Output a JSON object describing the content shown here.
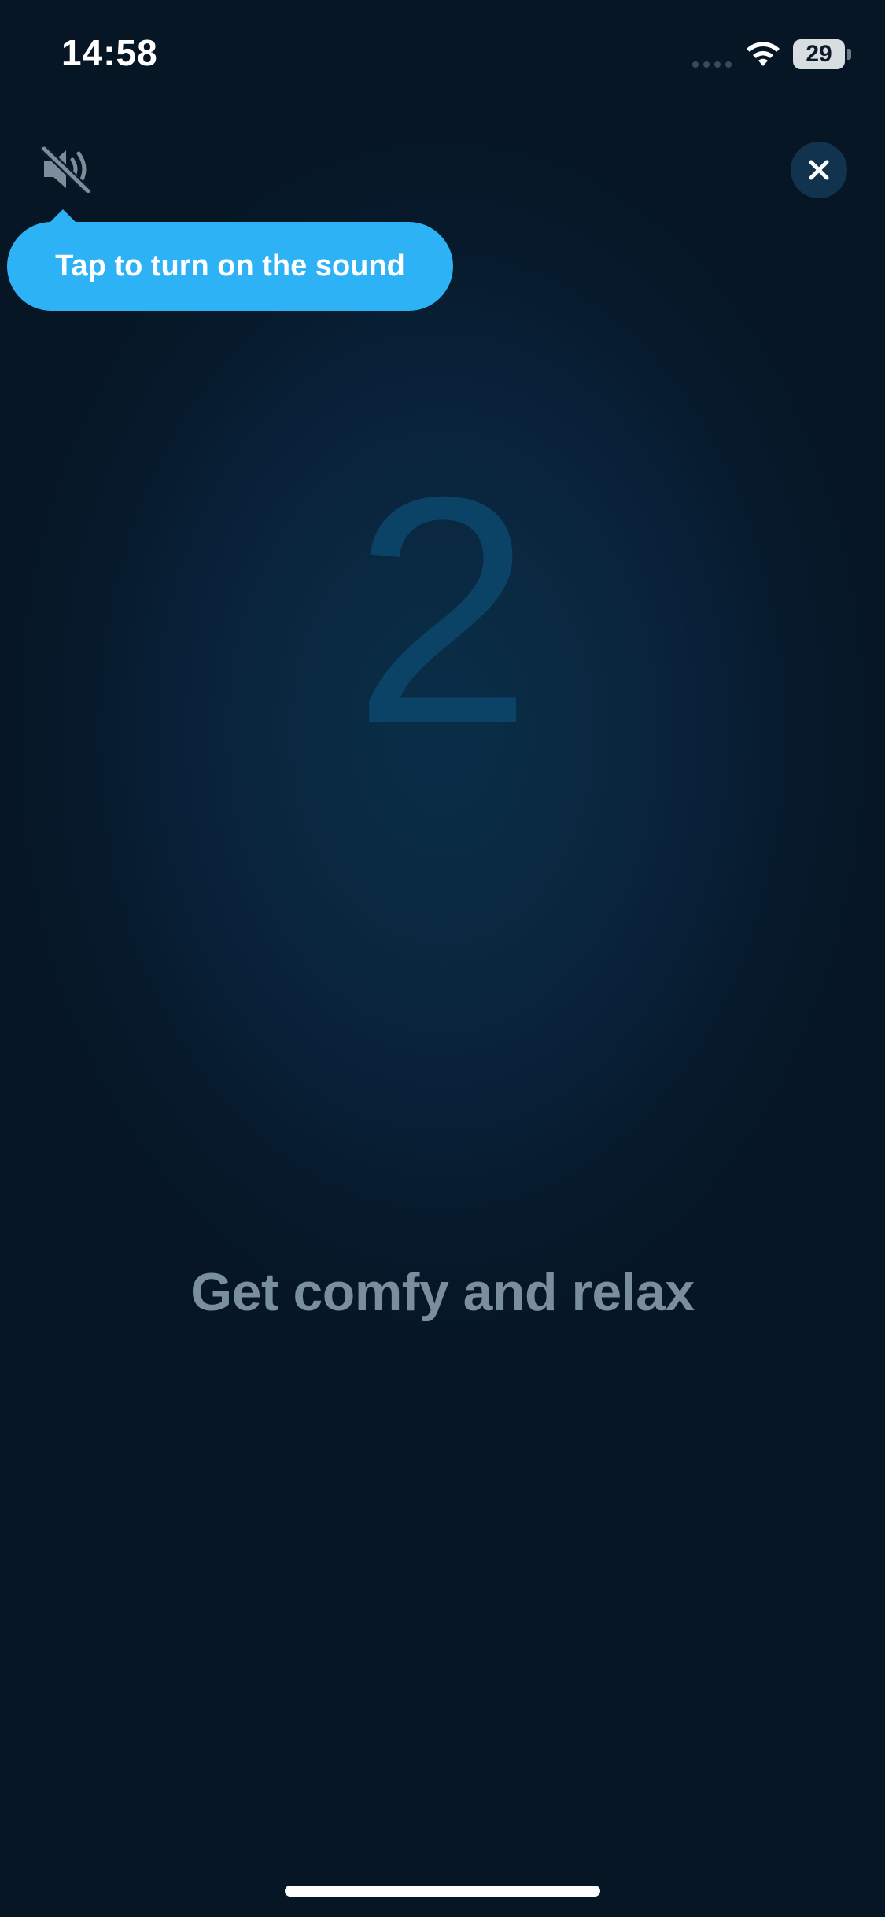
{
  "status_bar": {
    "time": "14:58",
    "battery": "29",
    "icons": [
      "wifi-icon",
      "battery-icon"
    ]
  },
  "sound": {
    "icon": "speaker-muted-icon",
    "tooltip": "Tap to turn on the sound"
  },
  "close": {
    "icon": "close-icon"
  },
  "countdown": {
    "value": "2"
  },
  "headline": "Get comfy and relax",
  "colors": {
    "background": "#061726",
    "accent": "#2db3f5",
    "countdown": "#0b4366",
    "headline": "#7a8f9e"
  }
}
